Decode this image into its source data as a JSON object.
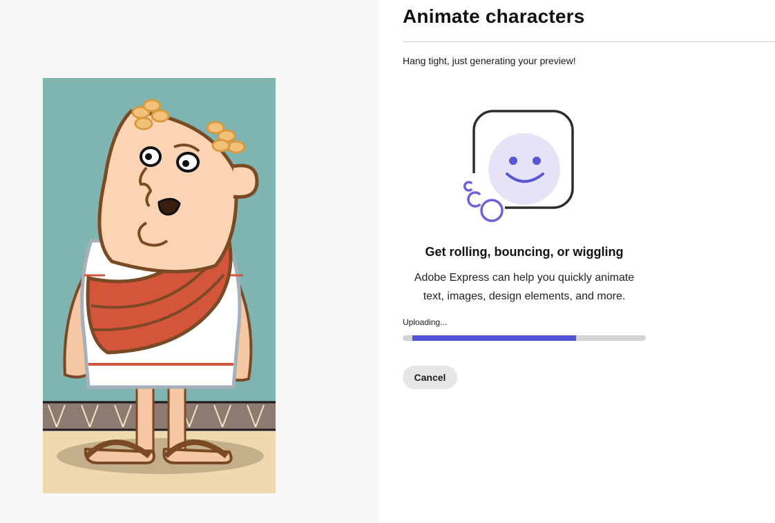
{
  "header": {
    "title": "Animate characters"
  },
  "status": {
    "message": "Hang tight, just generating your preview!"
  },
  "promo": {
    "illustration_icon": "smiley-face-icon",
    "headline": "Get rolling, bouncing, or wiggling",
    "description": "Adobe Express can help you quickly animate text, images, design elements, and more."
  },
  "upload": {
    "label": "Uploading...",
    "progress_fraction": 0.7
  },
  "actions": {
    "cancel_label": "Cancel"
  },
  "colors": {
    "accent": "#5052d9",
    "progress_track": "#d3d3d3",
    "left_background": "#f7f7f7",
    "preview_wall": "#7fb5b1",
    "toga_sash": "#d4553a"
  }
}
